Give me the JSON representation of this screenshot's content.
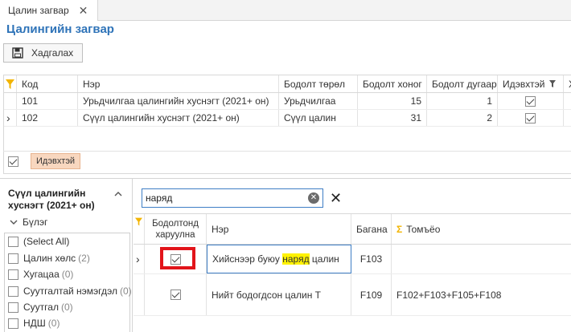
{
  "tab": {
    "label": "Цалин загвар",
    "close": "✕"
  },
  "page_title": "Цалингийн загвар",
  "toolbar": {
    "save_label": "Хадгалах"
  },
  "top_grid": {
    "columns": [
      "Код",
      "Нэр",
      "Бодолт төрөл",
      "Бодолт хоног",
      "Бодолт дугаар",
      "Идэвхтэй",
      "Х"
    ],
    "rows": [
      {
        "indicator": "",
        "code": "101",
        "name": "Урьдчилгаа цалингийн хуснэгт (2021+ он)",
        "type": "Урьдчилгаа",
        "days": "15",
        "number": "1",
        "active": true
      },
      {
        "indicator": "›",
        "code": "102",
        "name": "Сүүл цалингийн хуснэгт (2021+ он)",
        "type": "Сүүл цалин",
        "days": "31",
        "number": "2",
        "active": true
      }
    ],
    "filter_tag": "Идэвхтэй"
  },
  "left_panel": {
    "title": "Сүүл цалингийн хуснэгт (2021+ он)",
    "group_label": "Бүлэг",
    "items": [
      {
        "label": "(Select All)",
        "count": ""
      },
      {
        "label": "Цалин хөлс",
        "count": "(2)"
      },
      {
        "label": "Хугацаа",
        "count": "(0)"
      },
      {
        "label": "Суутгалтай нэмэгдэл",
        "count": "(0)"
      },
      {
        "label": "Суутгал",
        "count": "(0)"
      },
      {
        "label": "НДШ",
        "count": "(0)"
      }
    ]
  },
  "search": {
    "value": "наряд"
  },
  "right_grid": {
    "columns": [
      "Бодолтонд харуулна",
      "Нэр",
      "Багана",
      "Томъёо"
    ],
    "rows": [
      {
        "indicator": "›",
        "show": true,
        "name_prefix": "Хийснээр буюу ",
        "name_highlight": "наряд",
        "name_suffix": " цалин",
        "column": "F103",
        "formula": ""
      },
      {
        "indicator": "",
        "show": true,
        "name": "Нийт бодогдсон цалин Т",
        "column": "F109",
        "formula": "F102+F103+F105+F108"
      }
    ]
  },
  "colors": {
    "accent": "#2e73b8",
    "highlight": "#fff200",
    "alert_frame": "#e2141a",
    "filter_tag": "#f8d7bf",
    "funnel": "#f2b400"
  }
}
